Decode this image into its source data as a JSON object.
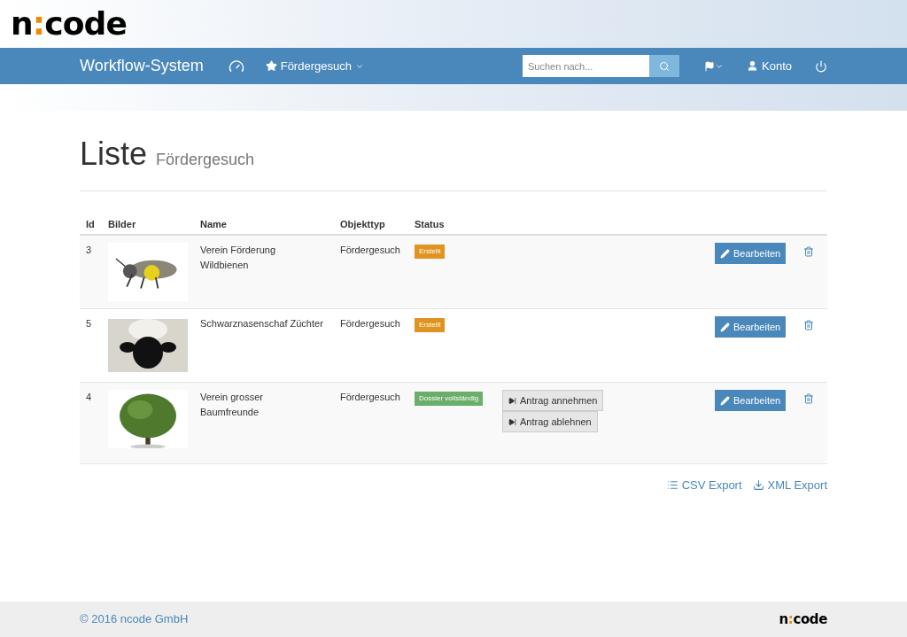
{
  "header": {
    "logo": {
      "start": "n",
      "separator": ":",
      "end": "code"
    }
  },
  "navbar": {
    "brand": "Workflow-System",
    "menu": "Fördergesuch",
    "search": {
      "placeholder": "Suchen nach..."
    },
    "account": "Konto"
  },
  "page": {
    "title": "Liste",
    "subtitle": "Fördergesuch"
  },
  "table": {
    "columns": [
      "Id",
      "Bilder",
      "Name",
      "Objekttyp",
      "Status"
    ],
    "rows": [
      {
        "id": "3",
        "name": "Verein Förderung Wildbienen",
        "type": "Fördergesuch",
        "status": {
          "label": "Erstellt",
          "color": "#e0941f"
        },
        "actions": [],
        "edit": "Bearbeiten"
      },
      {
        "id": "5",
        "name": "Schwarznasenschaf Züchter",
        "type": "Fördergesuch",
        "status": {
          "label": "Erstellt",
          "color": "#e0941f"
        },
        "actions": [],
        "edit": "Bearbeiten"
      },
      {
        "id": "4",
        "name": "Verein grosser Baumfreunde",
        "type": "Fördergesuch",
        "status": {
          "label": "Dossier vollständig",
          "color": "#6aae6a"
        },
        "actions": [
          "Antrag annehmen",
          "Antrag ablehnen"
        ],
        "edit": "Bearbeiten"
      }
    ]
  },
  "exports": [
    "CSV Export",
    "XML Export"
  ],
  "footer": {
    "copyright": "© 2016 ncode GmbH",
    "logo": {
      "start": "n",
      "separator": ":",
      "end": "code"
    }
  }
}
